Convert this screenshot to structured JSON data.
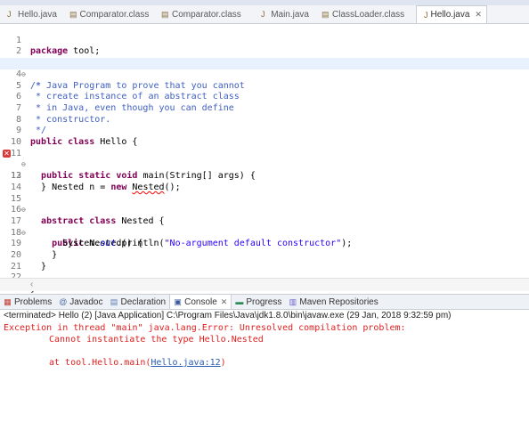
{
  "editor_tabs": [
    {
      "label": "Hello.java",
      "icon": "java-file-icon"
    },
    {
      "label": "Comparator.class",
      "icon": "class-file-icon"
    },
    {
      "label": "Comparator.class",
      "icon": "class-file-icon"
    },
    {
      "label": "Main.java",
      "icon": "java-file-icon"
    },
    {
      "label": "ClassLoader.class",
      "icon": "class-file-icon"
    },
    {
      "label": "Hello.java",
      "icon": "java-file-icon",
      "active": true
    }
  ],
  "code": {
    "line_numbers": [
      "1",
      "2",
      "3",
      "4",
      "5",
      "6",
      "7",
      "8",
      "9",
      "10",
      "11",
      "12",
      "13",
      "14",
      "15",
      "16",
      "17",
      "18",
      "19",
      "20",
      "21",
      "22"
    ],
    "l1": {
      "kw": "package",
      "rest": " tool;"
    },
    "l3": "/*",
    "l4": " * Java Program to prove that you cannot",
    "l5": " * create instance of an abstract class",
    "l6": " * in Java, even though you can define",
    "l7": " * constructor.",
    "l8": " */",
    "l9": {
      "kw": "public class",
      "rest": " Hello {"
    },
    "l11": {
      "kw": "public static void",
      "rest": " main(String[] args) {"
    },
    "l12": {
      "pre": "    Nested n = ",
      "kw": "new",
      "sp": " ",
      "err": "Nested",
      "post": "();"
    },
    "l13": "  }",
    "l15": {
      "kw": "abstract class",
      "rest": " Nested {"
    },
    "l17": {
      "kw": "public",
      "rest": " Nested() {"
    },
    "l18": {
      "pre": "      System.",
      "field": "out",
      "mid": ".println(",
      "str": "\"No-argument default constructor\"",
      "post": ");"
    },
    "l19": "    }",
    "l20": "  }",
    "l22": "}"
  },
  "view_tabs": [
    {
      "label": "Problems",
      "icon": "problems-icon"
    },
    {
      "label": "Javadoc",
      "icon": "javadoc-icon"
    },
    {
      "label": "Declaration",
      "icon": "declaration-icon"
    },
    {
      "label": "Console",
      "icon": "console-icon",
      "active": true
    },
    {
      "label": "Progress",
      "icon": "progress-icon"
    },
    {
      "label": "Maven Repositories",
      "icon": "maven-icon"
    }
  ],
  "console": {
    "status": "<terminated> Hello (2) [Java Application] C:\\Program Files\\Java\\jdk1.8.0\\bin\\javaw.exe (29 Jan, 2018 9:32:59 pm)",
    "line1": "Exception in thread \"main\" java.lang.Error: Unresolved compilation problem: ",
    "line2": "\tCannot instantiate the type Hello.Nested",
    "line3_pre": "\tat tool.Hello.main(",
    "line3_link": "Hello.java:12",
    "line3_post": ")"
  },
  "colors": {
    "keyword": "#7f0055",
    "comment": "#3f5fbf",
    "string": "#2a00ff",
    "error": "#e02020",
    "link": "#2a5db0"
  }
}
